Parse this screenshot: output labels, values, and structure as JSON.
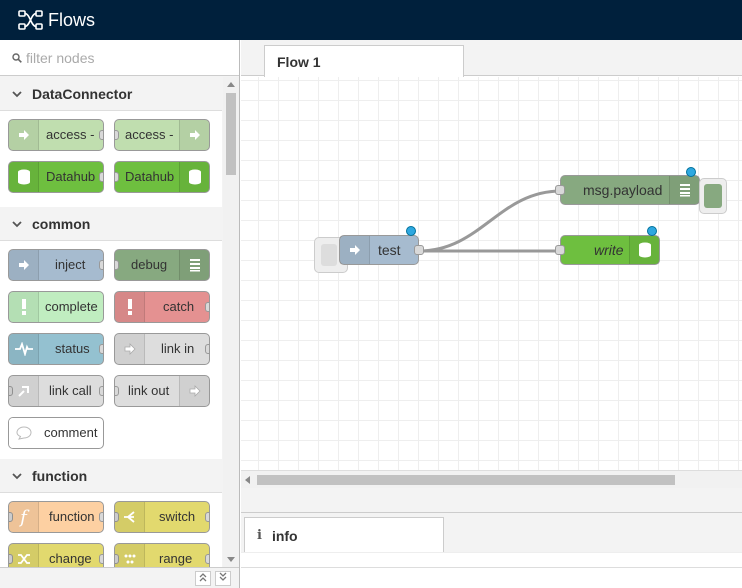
{
  "header": {
    "title": "Flows",
    "logo_icon": "node-red-logo-icon",
    "background": "#00203c"
  },
  "palette": {
    "filter_placeholder": "filter nodes",
    "categories": [
      {
        "name": "DataConnector",
        "nodes": [
          {
            "label": "access -",
            "color": "#c0deaf",
            "icon": "arrow-in-icon"
          },
          {
            "label": "access -",
            "color": "#c0deaf",
            "icon": "arrow-out-icon"
          },
          {
            "label": "Datahub",
            "color": "#6ebf3f",
            "icon": "database-icon"
          },
          {
            "label": "Datahub",
            "color": "#6ebf3f",
            "icon": "database-icon"
          }
        ]
      },
      {
        "name": "common",
        "nodes": [
          {
            "label": "inject",
            "color": "#a6bbcf",
            "icon": "arrow-in-icon"
          },
          {
            "label": "debug",
            "color": "#87a980",
            "icon": "list-icon"
          },
          {
            "label": "complete",
            "color": "#c0edc0",
            "icon": "exclamation-icon"
          },
          {
            "label": "catch",
            "color": "#e49191",
            "icon": "exclamation-icon"
          },
          {
            "label": "status",
            "color": "#94c1d0",
            "icon": "pulse-icon"
          },
          {
            "label": "link in",
            "color": "#dddddd",
            "icon": "link-in-icon"
          },
          {
            "label": "link call",
            "color": "#dddddd",
            "icon": "link-call-icon"
          },
          {
            "label": "link out",
            "color": "#dddddd",
            "icon": "link-out-icon"
          },
          {
            "label": "comment",
            "color": "#ffffff",
            "icon": "comment-icon"
          }
        ]
      },
      {
        "name": "function",
        "nodes": [
          {
            "label": "function",
            "color": "#fdd0a2",
            "icon": "function-icon"
          },
          {
            "label": "switch",
            "color": "#e2d96e",
            "icon": "switch-icon"
          },
          {
            "label": "change",
            "color": "#e2d96e",
            "icon": "shuffle-icon"
          },
          {
            "label": "range",
            "color": "#e2d96e",
            "icon": "range-icon"
          }
        ]
      }
    ]
  },
  "workspace": {
    "tab_label": "Flow 1",
    "nodes": {
      "test": {
        "label": "test",
        "color": "#a6bbcf",
        "icon": "arrow-in-icon"
      },
      "msg_payload": {
        "label": "msg.payload",
        "color": "#87a980",
        "icon": "list-icon"
      },
      "write": {
        "label": "write",
        "color": "#6ebf3f",
        "icon": "database-icon"
      }
    }
  },
  "sidebar": {
    "tab_label": "info",
    "icon": "info-icon"
  }
}
